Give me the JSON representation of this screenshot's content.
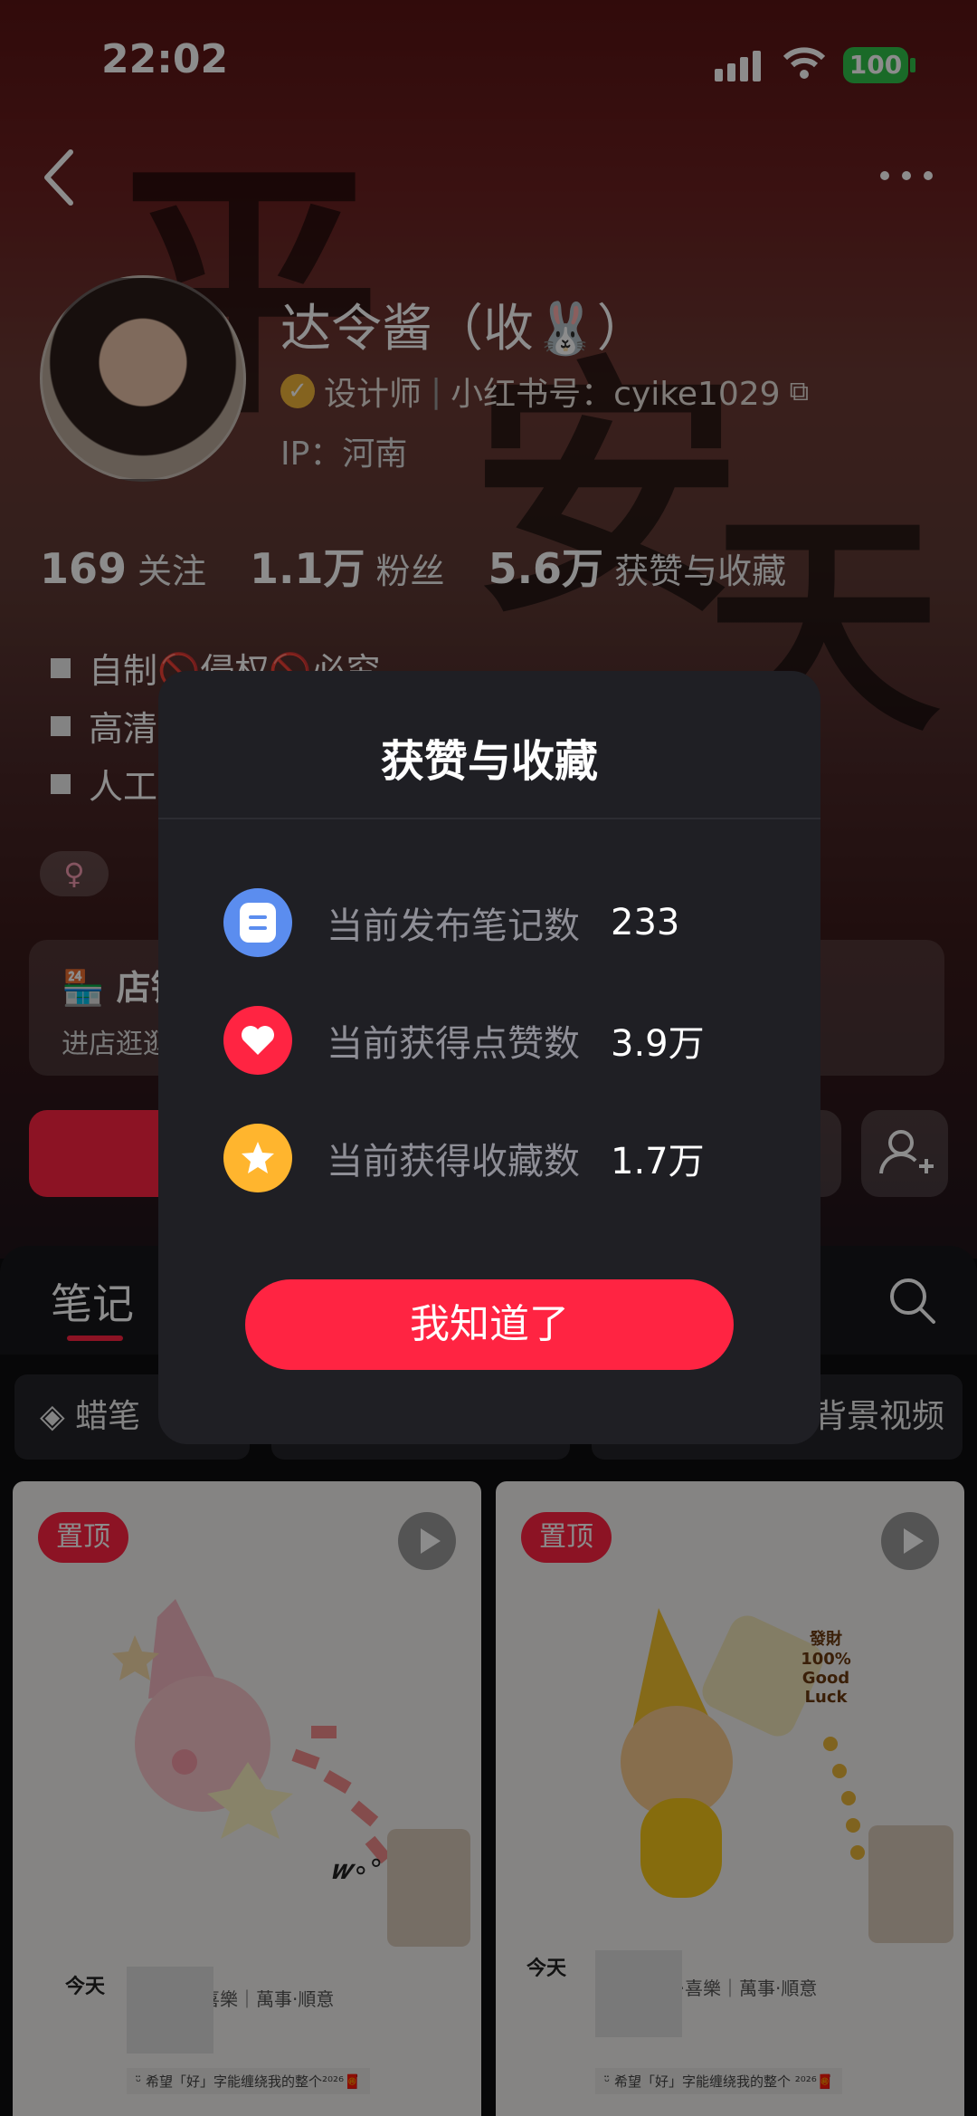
{
  "status_bar": {
    "time": "22:02",
    "battery": "100"
  },
  "profile": {
    "name": "达令酱（收🐰）",
    "title": "设计师",
    "account_id": "小红书号：cyike1029",
    "ip": "IP：河南",
    "gender": "♀",
    "stats": [
      {
        "num": "169",
        "label": "关注"
      },
      {
        "num": "1.1万",
        "label": "粉丝"
      },
      {
        "num": "5.6万",
        "label": "获赞与收藏"
      }
    ],
    "bio_lines": [
      "自制🚫侵权🚫必究",
      "高清",
      "人工"
    ]
  },
  "shop": {
    "title": "店铺",
    "subtitle": "进店逛逛"
  },
  "tabs": {
    "notes": "笔记"
  },
  "chips": [
    "蜡笔",
    "背景视频"
  ],
  "cards": [
    {
      "pin": "置顶",
      "caption": "平安·喜樂｜萬事·順意",
      "today": "今天",
      "strip": "ᵕ̈ 希望「好」字能缠绕我的整个²⁰²⁶🧧",
      "mark": "𝒘∘°"
    },
    {
      "pin": "置顶",
      "caption": "平安·喜樂｜萬事·順意",
      "today": "今天",
      "strip": "ᵕ̈ 希望「好」字能缠绕我的整个 ²⁰²⁶🧧",
      "jar": "發財 100% Good Luck"
    }
  ],
  "modal": {
    "title": "获赞与收藏",
    "rows": [
      {
        "icon": "note-icon",
        "color": "#5b8def",
        "label": "当前发布笔记数",
        "value": "233"
      },
      {
        "icon": "heart-icon",
        "color": "#ff2442",
        "label": "当前获得点赞数",
        "value": "3.9万"
      },
      {
        "icon": "star-icon",
        "color": "#ffb52e",
        "label": "当前获得收藏数",
        "value": "1.7万"
      }
    ],
    "button": "我知道了"
  }
}
